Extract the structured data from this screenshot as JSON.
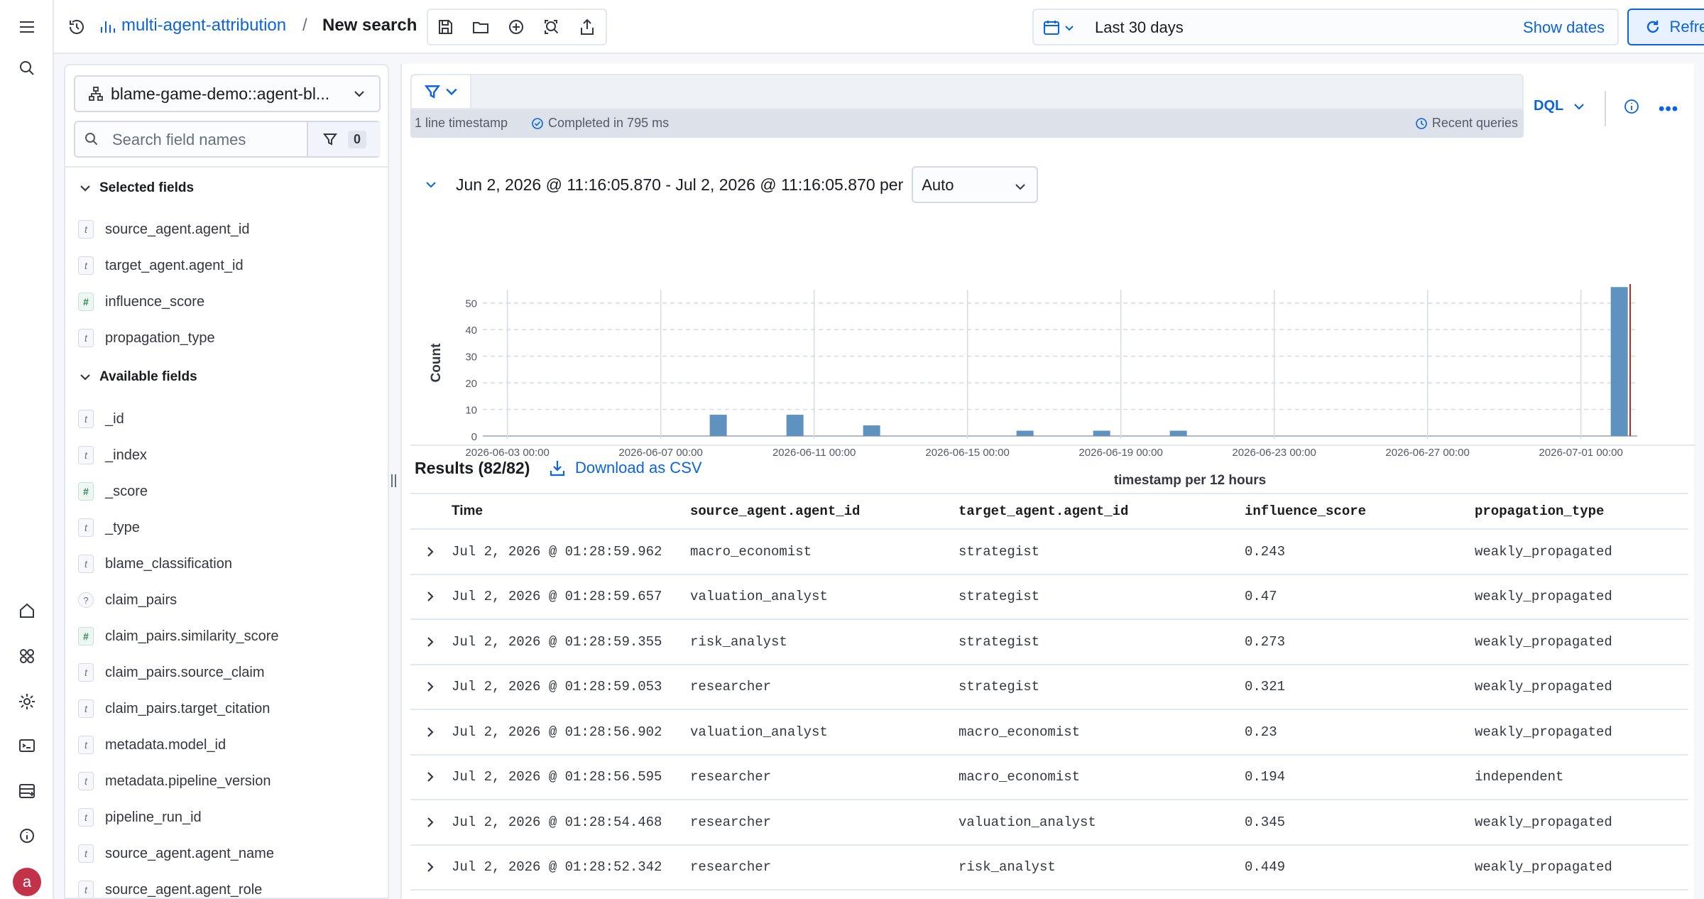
{
  "breadcrumb": {
    "app": "multi-agent-attribution",
    "separator": "/",
    "current": "New search"
  },
  "date_picker": {
    "range": "Last 30 days",
    "show_dates": "Show dates"
  },
  "refresh_label": "Refresh",
  "sidebar": {
    "data_view": "blame-game-demo::agent-bl...",
    "search_placeholder": "Search field names",
    "filter_count": "0",
    "selected_heading": "Selected fields",
    "selected_fields": [
      {
        "type": "t",
        "name": "source_agent.agent_id"
      },
      {
        "type": "t",
        "name": "target_agent.agent_id"
      },
      {
        "type": "#",
        "name": "influence_score"
      },
      {
        "type": "t",
        "name": "propagation_type"
      }
    ],
    "available_heading": "Available fields",
    "available_fields": [
      {
        "type": "t",
        "name": "_id"
      },
      {
        "type": "t",
        "name": "_index"
      },
      {
        "type": "#",
        "name": "_score"
      },
      {
        "type": "t",
        "name": "_type"
      },
      {
        "type": "t",
        "name": "blame_classification"
      },
      {
        "type": "?",
        "name": "claim_pairs"
      },
      {
        "type": "#",
        "name": "claim_pairs.similarity_score"
      },
      {
        "type": "t",
        "name": "claim_pairs.source_claim"
      },
      {
        "type": "t",
        "name": "claim_pairs.target_citation"
      },
      {
        "type": "t",
        "name": "metadata.model_id"
      },
      {
        "type": "t",
        "name": "metadata.pipeline_version"
      },
      {
        "type": "t",
        "name": "pipeline_run_id"
      },
      {
        "type": "t",
        "name": "source_agent.agent_name"
      },
      {
        "type": "t",
        "name": "source_agent.agent_role"
      }
    ]
  },
  "query": {
    "status_lines": "1 line timestamp",
    "status_completed": "Completed in 795 ms",
    "recent_queries": "Recent queries",
    "language": "DQL"
  },
  "histogram": {
    "range_text": "Jun 2, 2026 @ 11:16:05.870 - Jul 2, 2026 @ 11:16:05.870 per",
    "interval": "Auto"
  },
  "chart_data": {
    "type": "bar",
    "xlabel": "timestamp per 12 hours",
    "ylabel": "Count",
    "ylim": [
      0,
      55
    ],
    "y_ticks": [
      0,
      10,
      20,
      30,
      40,
      50
    ],
    "x_tick_labels": [
      "2026-06-03 00:00",
      "2026-06-07 00:00",
      "2026-06-11 00:00",
      "2026-06-15 00:00",
      "2026-06-19 00:00",
      "2026-06-23 00:00",
      "2026-06-27 00:00",
      "2026-07-01 00:00"
    ],
    "bars": [
      {
        "x": "2026-06-08 12:00",
        "value": 8
      },
      {
        "x": "2026-06-10 12:00",
        "value": 8
      },
      {
        "x": "2026-06-12 12:00",
        "value": 4
      },
      {
        "x": "2026-06-16 12:00",
        "value": 2
      },
      {
        "x": "2026-06-18 12:00",
        "value": 2
      },
      {
        "x": "2026-06-20 12:00",
        "value": 2
      },
      {
        "x": "2026-07-02 00:00",
        "value": 56
      }
    ],
    "bar_color": "#6092c0",
    "now_marker_color": "#bd271e"
  },
  "results": {
    "title": "Results (82/82)",
    "download": "Download as CSV",
    "columns": [
      "Time",
      "source_agent.agent_id",
      "target_agent.agent_id",
      "influence_score",
      "propagation_type"
    ],
    "rows": [
      [
        "Jul 2, 2026 @ 01:28:59.962",
        "macro_economist",
        "strategist",
        "0.243",
        "weakly_propagated"
      ],
      [
        "Jul 2, 2026 @ 01:28:59.657",
        "valuation_analyst",
        "strategist",
        "0.47",
        "weakly_propagated"
      ],
      [
        "Jul 2, 2026 @ 01:28:59.355",
        "risk_analyst",
        "strategist",
        "0.273",
        "weakly_propagated"
      ],
      [
        "Jul 2, 2026 @ 01:28:59.053",
        "researcher",
        "strategist",
        "0.321",
        "weakly_propagated"
      ],
      [
        "Jul 2, 2026 @ 01:28:56.902",
        "valuation_analyst",
        "macro_economist",
        "0.23",
        "weakly_propagated"
      ],
      [
        "Jul 2, 2026 @ 01:28:56.595",
        "researcher",
        "macro_economist",
        "0.194",
        "independent"
      ],
      [
        "Jul 2, 2026 @ 01:28:54.468",
        "researcher",
        "valuation_analyst",
        "0.345",
        "weakly_propagated"
      ],
      [
        "Jul 2, 2026 @ 01:28:52.342",
        "researcher",
        "risk_analyst",
        "0.449",
        "weakly_propagated"
      ]
    ]
  },
  "user": {
    "avatar_letter": "a"
  },
  "colors": {
    "accent": "#0b64dd",
    "bar": "#6092c0",
    "avatar": "#c2334a"
  }
}
